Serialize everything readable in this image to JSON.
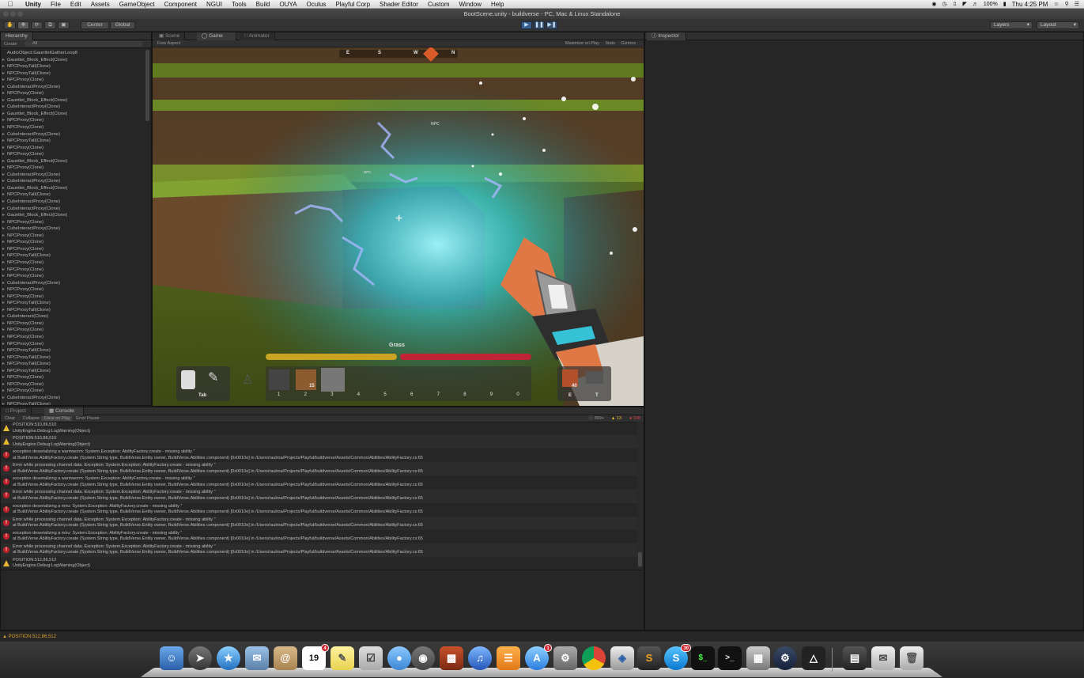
{
  "menubar": {
    "apple": "",
    "items": [
      "Unity",
      "File",
      "Edit",
      "Assets",
      "GameObject",
      "Component",
      "NGUI",
      "Tools",
      "Build",
      "OUYA",
      "Oculus",
      "Playful Corp",
      "Shader Editor",
      "Custom",
      "Window",
      "Help"
    ],
    "battery": "100%",
    "clock": "Thu 4:25 PM"
  },
  "window": {
    "title": "BootScene.unity - buildverse - PC, Mac & Linux Standalone"
  },
  "toolbar": {
    "pivot": "Center",
    "space": "Global",
    "layers": "Layers",
    "layout": "Layout"
  },
  "hierarchy": {
    "tab": "Hierarchy",
    "create": "Create",
    "search_placeholder": "All",
    "items": [
      "AudioObject:GauntletGatherLoop8",
      "Gauntlet_Block_Effect(Clone)",
      "NPCProxyTall(Clone)",
      "NPCProxyTall(Clone)",
      "NPCProxy(Clone)",
      "CubeInteractProxy(Clone)",
      "NPCProxy(Clone)",
      "Gauntlet_Block_Effect(Clone)",
      "CubeInteractProxy(Clone)",
      "Gauntlet_Block_Effect(Clone)",
      "NPCProxy(Clone)",
      "NPCProxy(Clone)",
      "CubeInteractProxy(Clone)",
      "NPCProxyTall(Clone)",
      "NPCProxy(Clone)",
      "NPCProxy(Clone)",
      "Gauntlet_Block_Effect(Clone)",
      "NPCProxy(Clone)",
      "CubeInteractProxy(Clone)",
      "CubeInteractProxy(Clone)",
      "Gauntlet_Block_Effect(Clone)",
      "NPCProxyTall(Clone)",
      "CubeInteractProxy(Clone)",
      "CubeInteractProxy(Clone)",
      "Gauntlet_Block_Effect(Clone)",
      "NPCProxy(Clone)",
      "CubeInteractProxy(Clone)",
      "NPCProxy(Clone)",
      "NPCProxy(Clone)",
      "NPCProxy(Clone)",
      "NPCProxyTall(Clone)",
      "NPCProxy(Clone)",
      "NPCProxy(Clone)",
      "NPCProxy(Clone)",
      "CubeInteractProxy(Clone)",
      "NPCProxy(Clone)",
      "NPCProxy(Clone)",
      "NPCProxyTall(Clone)",
      "NPCProxyTall(Clone)",
      "CubeInteract(Clone)",
      "NPCProxy(Clone)",
      "NPCProxy(Clone)",
      "NPCProxy(Clone)",
      "NPCProxy(Clone)",
      "NPCProxyTall(Clone)",
      "NPCProxyTall(Clone)",
      "NPCProxyTall(Clone)",
      "NPCProxyTall(Clone)",
      "NPCProxy(Clone)",
      "NPCProxy(Clone)",
      "NPCProxy(Clone)",
      "CubeInteractProxy(Clone)",
      "NPCProxyTall(Clone)",
      "NPCProxyTall(Clone)"
    ]
  },
  "scene_tabs": {
    "scene": "Scene",
    "game": "Game",
    "animator": "Animator",
    "aspect": "Free Aspect",
    "maximize": "Maximize on Play",
    "stats": "Stats",
    "gizmos": "Gizmos"
  },
  "game": {
    "compass": [
      "E",
      "S",
      "W",
      "N"
    ],
    "npc_label_1": "NPC",
    "npc_label_2": "NPC",
    "target_label": "Grass",
    "health_fraction": 0.5,
    "tab_label": "Tab",
    "slots": [
      "1",
      "2",
      "3",
      "4",
      "5",
      "6",
      "7",
      "8",
      "9",
      "0"
    ],
    "slot2_count": "15",
    "right_slots": [
      "E",
      "T"
    ],
    "right_count": "40"
  },
  "inspector": {
    "tab": "Inspector"
  },
  "bottom_tabs": {
    "project": "Project",
    "console": "Console"
  },
  "console": {
    "buttons": [
      "Clear",
      "Collapse",
      "Clear on Play",
      "Error Pause"
    ],
    "counts": {
      "log": "999+",
      "warn": "13",
      "error": "198"
    },
    "entries": [
      {
        "type": "warn",
        "line1": "POSITION:510,86,510",
        "line2": "UnityEngine.Debug:LogWarning(Object)"
      },
      {
        "type": "warn",
        "line1": "POSITION:510,86,510",
        "line2": "UnityEngine.Debug:LogWarning(Object)"
      },
      {
        "type": "error",
        "line1": "exception deserializing a warmworm: System.Exception: AbilityFactory.create - missing ability ''",
        "line2": "  at BuildVerse.AbilityFactory.create (System.String type, BuildVerse.Entity owner, BuildVerse.Abilities component) [0x0010e] in /Users/raulroa/Projects/Playful/buildverse/Assets/Common/Abilities/AbilityFactory.cs:65"
      },
      {
        "type": "error",
        "line1": "Error while processing channel data. Exception: System.Exception: AbilityFactory.create - missing ability ''",
        "line2": "  at BuildVerse.AbilityFactory.create (System.String type, BuildVerse.Entity owner, BuildVerse.Abilities component) [0x0010e] in /Users/raulroa/Projects/Playful/buildverse/Assets/Common/Abilities/AbilityFactory.cs:65"
      },
      {
        "type": "error",
        "line1": "exception deserializing a warmworm: System.Exception: AbilityFactory.create - missing ability ''",
        "line2": "  at BuildVerse.AbilityFactory.create (System.String type, BuildVerse.Entity owner, BuildVerse.Abilities component) [0x0010e] in /Users/raulroa/Projects/Playful/buildverse/Assets/Common/Abilities/AbilityFactory.cs:65"
      },
      {
        "type": "error",
        "line1": "Error while processing channel data. Exception: System.Exception: AbilityFactory.create - missing ability ''",
        "line2": "  at BuildVerse.AbilityFactory.create (System.String type, BuildVerse.Entity owner, BuildVerse.Abilities component) [0x0010e] in /Users/raulroa/Projects/Playful/buildverse/Assets/Common/Abilities/AbilityFactory.cs:65"
      },
      {
        "type": "error",
        "line1": "exception deserializing a miru: System.Exception: AbilityFactory.create - missing ability ''",
        "line2": "  at BuildVerse.AbilityFactory.create (System.String type, BuildVerse.Entity owner, BuildVerse.Abilities component) [0x0010e] in /Users/raulroa/Projects/Playful/buildverse/Assets/Common/Abilities/AbilityFactory.cs:65"
      },
      {
        "type": "error",
        "line1": "Error while processing channel data. Exception: System.Exception: AbilityFactory.create - missing ability ''",
        "line2": "  at BuildVerse.AbilityFactory.create (System.String type, BuildVerse.Entity owner, BuildVerse.Abilities component) [0x0010e] in /Users/raulroa/Projects/Playful/buildverse/Assets/Common/Abilities/AbilityFactory.cs:65"
      },
      {
        "type": "error",
        "line1": "exception deserializing a miru: System.Exception: AbilityFactory.create - missing ability ''",
        "line2": "  at BuildVerse.AbilityFactory.create (System.String type, BuildVerse.Entity owner, BuildVerse.Abilities component) [0x0010e] in /Users/raulroa/Projects/Playful/buildverse/Assets/Common/Abilities/AbilityFactory.cs:65"
      },
      {
        "type": "error",
        "line1": "Error while processing channel data. Exception: System.Exception: AbilityFactory.create - missing ability ''",
        "line2": "  at BuildVerse.AbilityFactory.create (System.String type, BuildVerse.Entity owner, BuildVerse.Abilities component) [0x0010e] in /Users/raulroa/Projects/Playful/buildverse/Assets/Common/Abilities/AbilityFactory.cs:65"
      },
      {
        "type": "warn",
        "line1": "POSITION:512,86,512",
        "line2": "UnityEngine.Debug:LogWarning(Object)"
      }
    ]
  },
  "status": {
    "text": "POSITION:512,86,512"
  },
  "dock": {
    "calendar_day": "19",
    "calendar_badge": "4",
    "appstore_badge": "1",
    "skype_badge": "30"
  }
}
